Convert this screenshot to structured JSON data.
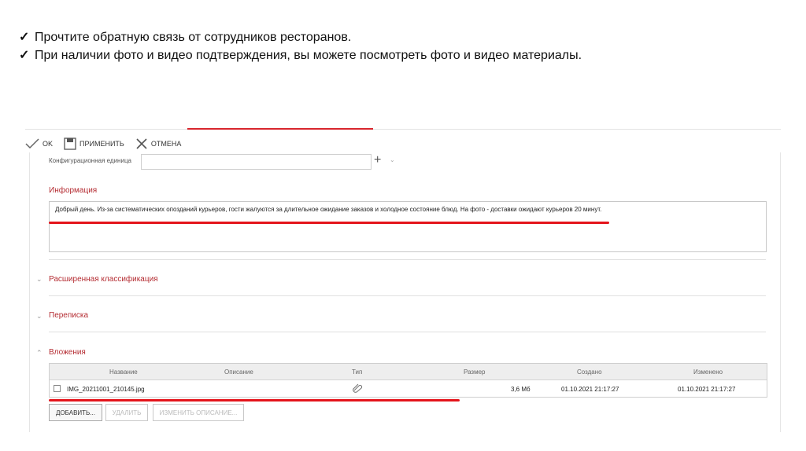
{
  "instructions": [
    {
      "check": "✓",
      "text": "Прочтите обратную связь от сотрудников ресторанов."
    },
    {
      "check": "✓",
      "text": "При наличии фото и видео подтверждения, вы можете посмотреть фото и видео материалы."
    }
  ],
  "toolbar": {
    "ok": "OK",
    "apply": "ПРИМЕНИТЬ",
    "cancel": "ОТМЕНА"
  },
  "config_unit": {
    "label": "Конфигурационная единица",
    "value": "",
    "add": "+",
    "dropdown": "⌄"
  },
  "information": {
    "title": "Информация",
    "text": "Добрый день. Из-за систематических опозданий курьеров, гости жалуются за длительное ожидание заказов и холодное состояние блюд. На фото -  доставки ожидают курьеров 20 минут."
  },
  "sections": {
    "extended": {
      "chevron": "⌄",
      "title": "Расширенная классификация"
    },
    "correspondence": {
      "chevron": "⌄",
      "title": "Переписка"
    },
    "attachments": {
      "chevron": "⌃",
      "title": "Вложения"
    }
  },
  "attachments_table": {
    "headers": {
      "name": "Название",
      "description": "Описание",
      "type": "Тип",
      "size": "Размер",
      "created": "Создано",
      "modified": "Изменено"
    },
    "rows": [
      {
        "name": "IMG_20211001_210145.jpg",
        "description": "",
        "type_icon": "paperclip-icon",
        "size": "3,6 Мб",
        "created": "01.10.2021 21:17:27",
        "modified": "01.10.2021 21:17:27"
      }
    ]
  },
  "buttons": {
    "add": "ДОБАВИТЬ...",
    "delete": "УДАЛИТЬ",
    "edit_description": "ИЗМЕНИТЬ ОПИСАНИЕ..."
  },
  "colors": {
    "section_title": "#b42b31",
    "annotation_underline": "#e4141b",
    "tab_accent": "#d8262e"
  }
}
